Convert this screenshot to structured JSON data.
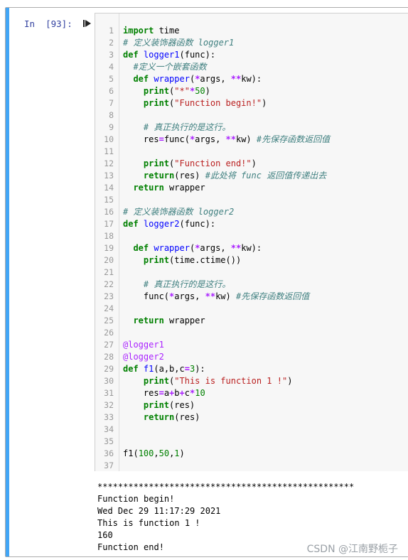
{
  "cell": {
    "prompt": "In  [93]:",
    "run_icon": "run-cell-icon"
  },
  "code_lines": [
    [
      {
        "t": "import",
        "c": "kw"
      },
      {
        "t": " time",
        "c": ""
      }
    ],
    [
      {
        "t": "# 定义装饰器函数 logger1",
        "c": "cm"
      }
    ],
    [
      {
        "t": "def",
        "c": "kw"
      },
      {
        "t": " ",
        "c": ""
      },
      {
        "t": "logger1",
        "c": "fn"
      },
      {
        "t": "(func):",
        "c": ""
      }
    ],
    [
      {
        "t": "  #定义一个嵌套函数",
        "c": "cm"
      }
    ],
    [
      {
        "t": "  ",
        "c": ""
      },
      {
        "t": "def",
        "c": "kw"
      },
      {
        "t": " ",
        "c": ""
      },
      {
        "t": "wrapper",
        "c": "fn"
      },
      {
        "t": "(",
        "c": ""
      },
      {
        "t": "*",
        "c": "op"
      },
      {
        "t": "args, ",
        "c": ""
      },
      {
        "t": "**",
        "c": "op"
      },
      {
        "t": "kw):",
        "c": ""
      }
    ],
    [
      {
        "t": "    ",
        "c": ""
      },
      {
        "t": "print",
        "c": "kw"
      },
      {
        "t": "(",
        "c": ""
      },
      {
        "t": "\"*\"",
        "c": "str"
      },
      {
        "t": "*",
        "c": "op"
      },
      {
        "t": "50",
        "c": "num"
      },
      {
        "t": ")",
        "c": ""
      }
    ],
    [
      {
        "t": "    ",
        "c": ""
      },
      {
        "t": "print",
        "c": "kw"
      },
      {
        "t": "(",
        "c": ""
      },
      {
        "t": "\"Function begin!\"",
        "c": "str"
      },
      {
        "t": ")",
        "c": ""
      }
    ],
    [],
    [
      {
        "t": "    # 真正执行的是这行。",
        "c": "cm"
      }
    ],
    [
      {
        "t": "    res",
        "c": ""
      },
      {
        "t": "=",
        "c": "op"
      },
      {
        "t": "func(",
        "c": ""
      },
      {
        "t": "*",
        "c": "op"
      },
      {
        "t": "args, ",
        "c": ""
      },
      {
        "t": "**",
        "c": "op"
      },
      {
        "t": "kw) ",
        "c": ""
      },
      {
        "t": "#先保存函数返回值",
        "c": "cm"
      }
    ],
    [],
    [
      {
        "t": "    ",
        "c": ""
      },
      {
        "t": "print",
        "c": "kw"
      },
      {
        "t": "(",
        "c": ""
      },
      {
        "t": "\"Function end!\"",
        "c": "str"
      },
      {
        "t": ")",
        "c": ""
      }
    ],
    [
      {
        "t": "    ",
        "c": ""
      },
      {
        "t": "return",
        "c": "kw"
      },
      {
        "t": "(res) ",
        "c": ""
      },
      {
        "t": "#此处将 func 返回值传递出去",
        "c": "cm"
      }
    ],
    [
      {
        "t": "  ",
        "c": ""
      },
      {
        "t": "return",
        "c": "kw"
      },
      {
        "t": " wrapper",
        "c": ""
      }
    ],
    [],
    [
      {
        "t": "# 定义装饰器函数 logger2",
        "c": "cm"
      }
    ],
    [
      {
        "t": "def",
        "c": "kw"
      },
      {
        "t": " ",
        "c": ""
      },
      {
        "t": "logger2",
        "c": "fn"
      },
      {
        "t": "(func):",
        "c": ""
      }
    ],
    [],
    [
      {
        "t": "  ",
        "c": ""
      },
      {
        "t": "def",
        "c": "kw"
      },
      {
        "t": " ",
        "c": ""
      },
      {
        "t": "wrapper",
        "c": "fn"
      },
      {
        "t": "(",
        "c": ""
      },
      {
        "t": "*",
        "c": "op"
      },
      {
        "t": "args, ",
        "c": ""
      },
      {
        "t": "**",
        "c": "op"
      },
      {
        "t": "kw):",
        "c": ""
      }
    ],
    [
      {
        "t": "    ",
        "c": ""
      },
      {
        "t": "print",
        "c": "kw"
      },
      {
        "t": "(time.ctime())",
        "c": ""
      }
    ],
    [],
    [
      {
        "t": "    # 真正执行的是这行。",
        "c": "cm"
      }
    ],
    [
      {
        "t": "    func(",
        "c": ""
      },
      {
        "t": "*",
        "c": "op"
      },
      {
        "t": "args, ",
        "c": ""
      },
      {
        "t": "**",
        "c": "op"
      },
      {
        "t": "kw) ",
        "c": ""
      },
      {
        "t": "#先保存函数返回值",
        "c": "cm"
      }
    ],
    [],
    [
      {
        "t": "  ",
        "c": ""
      },
      {
        "t": "return",
        "c": "kw"
      },
      {
        "t": " wrapper",
        "c": ""
      }
    ],
    [],
    [
      {
        "t": "@logger1",
        "c": "deco"
      }
    ],
    [
      {
        "t": "@logger2",
        "c": "deco"
      }
    ],
    [
      {
        "t": "def",
        "c": "kw"
      },
      {
        "t": " ",
        "c": ""
      },
      {
        "t": "f1",
        "c": "fn"
      },
      {
        "t": "(a,b,c",
        "c": ""
      },
      {
        "t": "=",
        "c": "op"
      },
      {
        "t": "3",
        "c": "num"
      },
      {
        "t": "):",
        "c": ""
      }
    ],
    [
      {
        "t": "    ",
        "c": ""
      },
      {
        "t": "print",
        "c": "kw"
      },
      {
        "t": "(",
        "c": ""
      },
      {
        "t": "\"This is function 1 !\"",
        "c": "str"
      },
      {
        "t": ")",
        "c": ""
      }
    ],
    [
      {
        "t": "    res",
        "c": ""
      },
      {
        "t": "=",
        "c": "op"
      },
      {
        "t": "a",
        "c": ""
      },
      {
        "t": "+",
        "c": "op"
      },
      {
        "t": "b",
        "c": ""
      },
      {
        "t": "+",
        "c": "op"
      },
      {
        "t": "c",
        "c": ""
      },
      {
        "t": "*",
        "c": "op"
      },
      {
        "t": "10",
        "c": "num"
      }
    ],
    [
      {
        "t": "    ",
        "c": ""
      },
      {
        "t": "print",
        "c": "kw"
      },
      {
        "t": "(res)",
        "c": ""
      }
    ],
    [
      {
        "t": "    ",
        "c": ""
      },
      {
        "t": "return",
        "c": "kw"
      },
      {
        "t": "(res)",
        "c": ""
      }
    ],
    [],
    [],
    [
      {
        "t": "f1(",
        "c": ""
      },
      {
        "t": "100",
        "c": "num"
      },
      {
        "t": ",",
        "c": ""
      },
      {
        "t": "50",
        "c": "num"
      },
      {
        "t": ",",
        "c": ""
      },
      {
        "t": "1",
        "c": "num"
      },
      {
        "t": ")",
        "c": ""
      }
    ],
    []
  ],
  "output_lines": [
    "**************************************************",
    "Function begin!",
    "Wed Dec 29 11:17:29 2021",
    "This is function 1 !",
    "160",
    "Function end!"
  ],
  "watermark": "CSDN @江南野栀子"
}
